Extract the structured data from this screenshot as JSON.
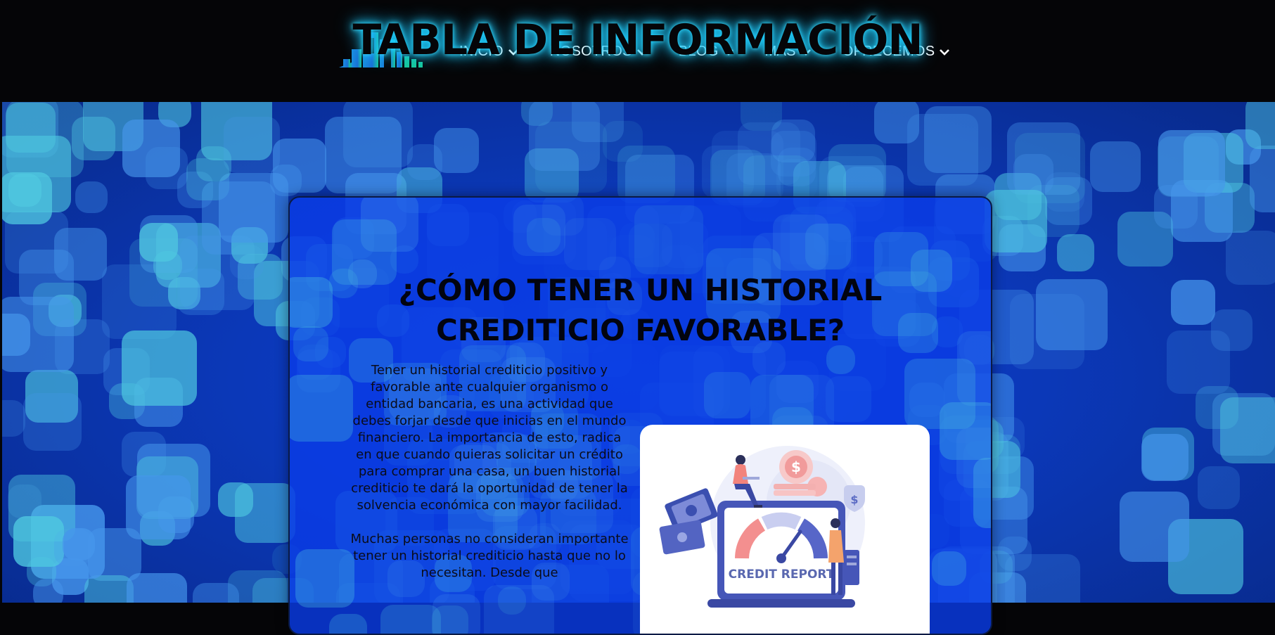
{
  "nav": {
    "items": [
      {
        "label": "INICIO"
      },
      {
        "label": "NOSOTROS"
      },
      {
        "label": "BLOG"
      },
      {
        "label": "MÁS"
      },
      {
        "label": "OFRECEMOS"
      }
    ]
  },
  "hero": {
    "title": "TABLA DE INFORMACIÓN"
  },
  "card": {
    "title_line1": "¿CÓMO TENER UN HISTORIAL",
    "title_line2": "CREDITICIO FAVORABLE?",
    "paragraph1": "Tener un historial crediticio positivo y favorable ante cualquier organismo o entidad bancaria, es una actividad que debes forjar desde que inicias en el mundo financiero. La importancia de esto, radica en que cuando quieras solicitar un crédito para comprar una casa, un buen historial crediticio te dará la oportunidad de tener la solvencia económica con mayor facilidad.",
    "paragraph2": "Muchas personas no consideran importante tener un historial crediticio hasta que no lo necesitan. Desde que",
    "image_label": "CREDIT REPORT"
  },
  "colors": {
    "nav_bg": "#050507",
    "accent_glow": "#1bd0ff",
    "card_bg": "#0a3ce6",
    "tile": "#4fc9e0"
  }
}
